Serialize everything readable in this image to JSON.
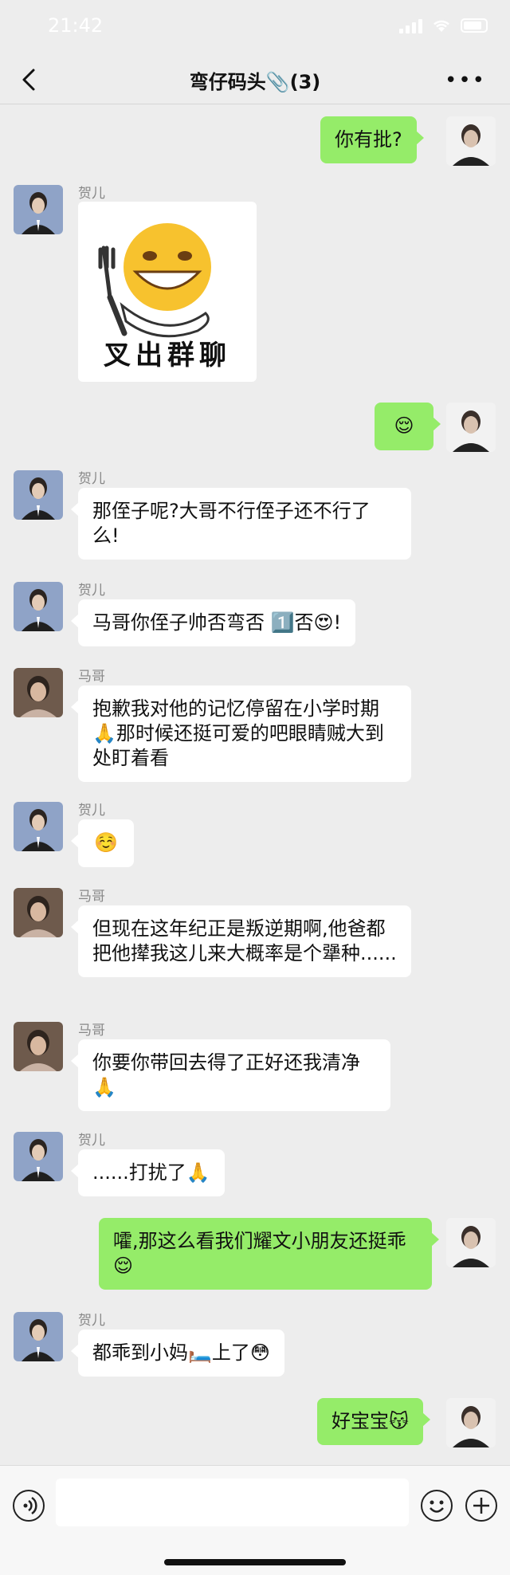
{
  "status": {
    "time": "21:42"
  },
  "header": {
    "title": "弯仔码头📎(3)",
    "more": "•••"
  },
  "sticker": {
    "caption": "叉出群聊"
  },
  "messages": [
    {
      "dir": "out",
      "text": "你有批?"
    },
    {
      "dir": "in",
      "sender": "贺儿",
      "type": "sticker"
    },
    {
      "dir": "out",
      "text": "😌"
    },
    {
      "dir": "in",
      "sender": "贺儿",
      "text": "那侄子呢?大哥不行侄子还不行了么!"
    },
    {
      "dir": "in",
      "sender": "贺儿",
      "text": "马哥你侄子帅否弯否 1️⃣否😍!"
    },
    {
      "dir": "in",
      "sender": "马哥",
      "text": "抱歉我对他的记忆停留在小学时期🙏那时候还挺可爱的吧眼睛贼大到处盯着看"
    },
    {
      "dir": "in",
      "sender": "贺儿",
      "text": "☺️"
    },
    {
      "dir": "in",
      "sender": "马哥",
      "text": "但现在这年纪正是叛逆期啊,他爸都把他撵我这儿来大概率是个犟种......"
    },
    {
      "dir": "in",
      "sender": "马哥",
      "text": "你要你带回去得了正好还我清净🙏"
    },
    {
      "dir": "in",
      "sender": "贺儿",
      "text": "......打扰了🙏"
    },
    {
      "dir": "out",
      "text": "嚯,那这么看我们耀文小朋友还挺乖😌"
    },
    {
      "dir": "in",
      "sender": "贺儿",
      "text": "都乖到小妈🛏️上了😳"
    },
    {
      "dir": "out",
      "text": "好宝宝😽"
    }
  ]
}
